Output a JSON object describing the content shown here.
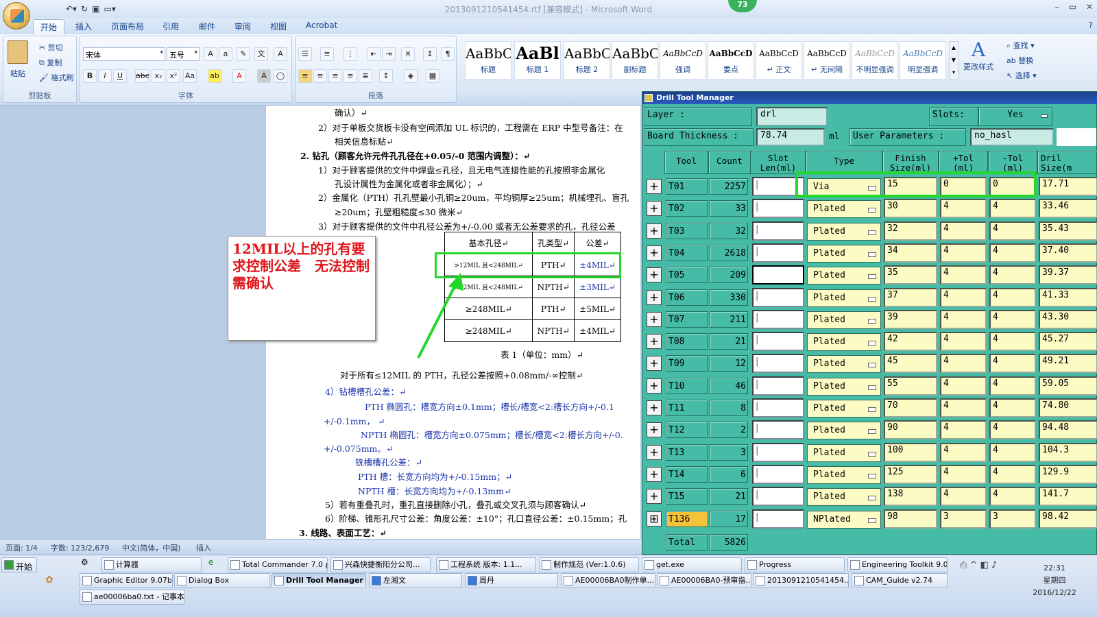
{
  "window": {
    "title": "2013091210541454.rtf [兼容模式] - Microsoft Word",
    "badge": "73"
  },
  "ribbon": {
    "tabs": [
      "开始",
      "插入",
      "页面布局",
      "引用",
      "邮件",
      "审阅",
      "视图",
      "Acrobat"
    ],
    "clipboard": {
      "paste": "粘贴",
      "cut": "剪切",
      "copy": "复制",
      "format_painter": "格式刷",
      "label": "剪贴板"
    },
    "font": {
      "name": "宋体",
      "size": "五号",
      "label": "字体"
    },
    "paragraph": {
      "label": "段落"
    },
    "styles": [
      {
        "sample": "AaBbC(",
        "name": "标题"
      },
      {
        "sample": "AaBl",
        "name": "标题 1"
      },
      {
        "sample": "AaBbC(",
        "name": "标题 2"
      },
      {
        "sample": "AaBbC(",
        "name": "副标题"
      },
      {
        "sample": "AaBbCcD",
        "name": "强调"
      },
      {
        "sample": "AaBbCcD",
        "name": "要点"
      },
      {
        "sample": "AaBbCcD",
        "name": "↵ 正文"
      },
      {
        "sample": "AaBbCcD",
        "name": "↵ 无间隔"
      },
      {
        "sample": "AaBbCcD",
        "name": "不明显强调"
      },
      {
        "sample": "AaBbCcD",
        "name": "明显强调"
      }
    ],
    "change_styles": "更改样式",
    "editing": {
      "find": "查找",
      "replace": "替换",
      "select": "选择"
    }
  },
  "document": {
    "lines": [
      "确认）↵",
      "2）对于单板交货板卡没有空间添加 UL 标识的，工程需在 ERP 中型号备注：在",
      "相关信息标贴↵",
      "2.  钻孔（顾客允许元件孔孔径在+0.05/-0 范围内调整）：↵",
      "1）对于顾客提供的文件中焊盘≤孔径，且无电气连接性能的孔按照非金属化",
      "孔设计属性为金属化或者非金属化）；↵",
      "2）金属化（PTH）孔孔壁最小孔铜≥20um，平均铜厚≥25um；机械埋孔、盲孔",
      "≥20um；孔壁粗糙度≤30 微米↵",
      "3）对于顾客提供的文件中孔径公差为+/-0.00 或者无公差要求的孔，孔径公差"
    ],
    "table": {
      "headers": [
        "基本孔径↵",
        "孔类型↵",
        "公差↵"
      ],
      "rows": [
        [
          ">12MIL 且<248MIL↵",
          "PTH↵",
          "±4MIL↵"
        ],
        [
          ">12MIL 且<248MIL↵",
          "NPTH↵",
          "±3MIL↵"
        ],
        [
          "≥248MIL↵",
          "PTH↵",
          "±5MIL↵"
        ],
        [
          "≥248MIL↵",
          "NPTH↵",
          "±4MIL↵"
        ]
      ],
      "caption": "表 1（单位：mm）↵"
    },
    "lines2": [
      "对于所有≤12MIL 的 PTH，孔径公差按照+0.08mm/-∞控制↵",
      "4）钻槽槽孔公差：↵",
      "PTH 椭圆孔：槽宽方向±0.1mm；槽长/槽宽<2:槽长方向+/-0.1",
      "+/-0.1mm，  ↵",
      "NPTH 椭圆孔：槽宽方向±0.075mm；槽长/槽宽<2:槽长方向+/-0.",
      "+/-0.075mm。↵",
      "铣槽槽孔公差：↵",
      "PTH 槽：长宽方向均为+/-0.15mm；↵",
      "NPTH 槽：长宽方向均为+/-0.13mm↵",
      "5）若有重叠孔时，重孔直接删除小孔，叠孔或交叉孔须与顾客确认↵",
      "6）阶梯、锥形孔尺寸公差：角度公差：±10°；孔口直径公差：±0.15mm；孔",
      "3.  线路、表面工艺：↵"
    ],
    "callout": "12MIL以上的孔有要求控制公差　无法控制需确认"
  },
  "statusbar": {
    "page": "页面: 1/4",
    "words": "字数: 123/2,679",
    "lang": "中文(简体，中国)",
    "mode": "插入"
  },
  "dtm": {
    "title": "Drill Tool Manager",
    "layer_label": "Layer            :",
    "layer": "drl",
    "slots_label": "Slots:",
    "slots": "Yes",
    "thickness_label": "Board Thickness :",
    "thickness": "78.74",
    "unit": "ml",
    "userparam_label": "User Parameters :",
    "userparam": "no_hasl",
    "headers": [
      "Tool",
      "Count",
      "Slot\nLen(ml)",
      "Type",
      "Finish\nSize(ml)",
      "+Tol\n(ml)",
      "-Tol\n(ml)",
      "Dril\nSize(m"
    ],
    "rows": [
      {
        "tool": "T01",
        "count": "2257",
        "type": "Via",
        "finish": "15",
        "ptol": "0",
        "ntol": "0",
        "drill": "17.71"
      },
      {
        "tool": "T02",
        "count": "33",
        "type": "Plated",
        "finish": "30",
        "ptol": "4",
        "ntol": "4",
        "drill": "33.46"
      },
      {
        "tool": "T03",
        "count": "32",
        "type": "Plated",
        "finish": "32",
        "ptol": "4",
        "ntol": "4",
        "drill": "35.43"
      },
      {
        "tool": "T04",
        "count": "2618",
        "type": "Plated",
        "finish": "34",
        "ptol": "4",
        "ntol": "4",
        "drill": "37.40"
      },
      {
        "tool": "T05",
        "count": "209",
        "type": "Plated",
        "finish": "35",
        "ptol": "4",
        "ntol": "4",
        "drill": "39.37"
      },
      {
        "tool": "T06",
        "count": "330",
        "type": "Plated",
        "finish": "37",
        "ptol": "4",
        "ntol": "4",
        "drill": "41.33"
      },
      {
        "tool": "T07",
        "count": "211",
        "type": "Plated",
        "finish": "39",
        "ptol": "4",
        "ntol": "4",
        "drill": "43.30"
      },
      {
        "tool": "T08",
        "count": "21",
        "type": "Plated",
        "finish": "42",
        "ptol": "4",
        "ntol": "4",
        "drill": "45.27"
      },
      {
        "tool": "T09",
        "count": "12",
        "type": "Plated",
        "finish": "45",
        "ptol": "4",
        "ntol": "4",
        "drill": "49.21"
      },
      {
        "tool": "T10",
        "count": "46",
        "type": "Plated",
        "finish": "55",
        "ptol": "4",
        "ntol": "4",
        "drill": "59.05"
      },
      {
        "tool": "T11",
        "count": "8",
        "type": "Plated",
        "finish": "70",
        "ptol": "4",
        "ntol": "4",
        "drill": "74.80"
      },
      {
        "tool": "T12",
        "count": "2",
        "type": "Plated",
        "finish": "90",
        "ptol": "4",
        "ntol": "4",
        "drill": "94.48"
      },
      {
        "tool": "T13",
        "count": "3",
        "type": "Plated",
        "finish": "100",
        "ptol": "4",
        "ntol": "4",
        "drill": "104.3"
      },
      {
        "tool": "T14",
        "count": "6",
        "type": "Plated",
        "finish": "125",
        "ptol": "4",
        "ntol": "4",
        "drill": "129.9"
      },
      {
        "tool": "T15",
        "count": "21",
        "type": "Plated",
        "finish": "138",
        "ptol": "4",
        "ntol": "4",
        "drill": "141.7"
      },
      {
        "tool": "T136",
        "count": "17",
        "type": "NPlated",
        "finish": "98",
        "ptol": "3",
        "ntol": "3",
        "drill": "98.42"
      }
    ],
    "total_label": "Total",
    "total": "5826"
  },
  "taskbar": {
    "start": "开始",
    "row1": [
      "计算器",
      "Total Commander 7.0 p...",
      "兴森快捷衡阳分公司...",
      "工程系统  版本: 1.1...",
      "制作规范 (Ver:1.0.6)",
      "get.exe",
      "Progress",
      "Engineering Toolkit 9.0..."
    ],
    "row2": [
      "Graphic Editor 9.07b...",
      "Dialog Box",
      "Drill Tool Manager",
      "左湘文",
      "周丹",
      "AE00006BA0制作单...",
      "AE00006BA0-预审指...",
      "2013091210541454....",
      "CAM_Guide v2.74"
    ],
    "row3": [
      "ae00006ba0.txt - 记事本"
    ],
    "clock": {
      "time": "22:31",
      "day": "星期四",
      "date": "2016/12/22"
    }
  },
  "colors": {
    "dtm_bg": "#46bca6",
    "highlight": "#24d72a",
    "callout_text": "#e0141a"
  }
}
